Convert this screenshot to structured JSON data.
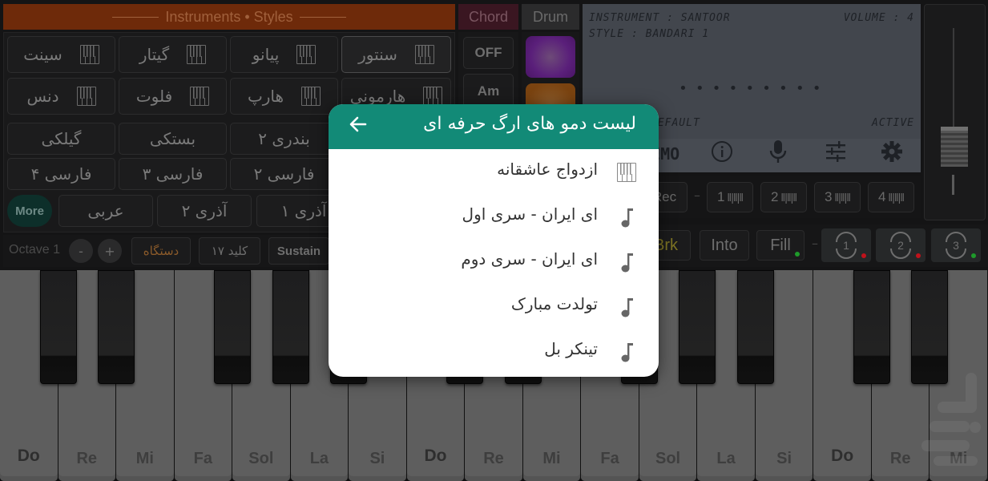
{
  "header": {
    "instruments_styles": "Instruments • Styles",
    "chord_tab": "Chord",
    "drum_tab": "Drum"
  },
  "instruments": [
    {
      "label": "سنتور",
      "active": true
    },
    {
      "label": "پیانو",
      "active": false
    },
    {
      "label": "گیتار",
      "active": false
    },
    {
      "label": "سینت",
      "active": false
    },
    {
      "label": "هارمونی",
      "active": false
    },
    {
      "label": "هارپ",
      "active": false
    },
    {
      "label": "فلوت",
      "active": false
    },
    {
      "label": "دنس",
      "active": false
    }
  ],
  "styles": [
    {
      "label": "بندری ۲"
    },
    {
      "label": "بستکی"
    },
    {
      "label": "گیلکی"
    },
    {
      "label": "فارسی ۲"
    },
    {
      "label": "فارسی ۳"
    },
    {
      "label": "فارسی ۴"
    },
    {
      "label": "آذری ۱"
    },
    {
      "label": "آذری ۲"
    },
    {
      "label": "عربی"
    }
  ],
  "more_label": "More",
  "controls": {
    "octave_label": "Octave 1",
    "minus": "-",
    "plus": "+",
    "dastgah": "دستگاه",
    "key": "کلید ۱۷",
    "sustain": "Sustain"
  },
  "chords": [
    "OFF",
    "Am"
  ],
  "drum_pads": [
    {
      "name": "pad-1",
      "color": "#5a1f7a"
    },
    {
      "name": "pad-2",
      "color": "#7a4310"
    }
  ],
  "lcd": {
    "instrument": "INSTRUMENT : SANTOOR",
    "volume": "VOLUME : 4",
    "style": "STYLE : BANDARI 1",
    "dots": "•••••••••",
    "default": "DEFAULT",
    "active": "ACTIVE",
    "demo": "DEMO"
  },
  "volume_slider": {
    "value_fraction": 0.7
  },
  "rec": {
    "rec_label": "Rec",
    "tracks": [
      "1",
      "2",
      "3",
      "4"
    ]
  },
  "style_controls": {
    "brk": "Brk",
    "into": "Into",
    "fill": "Fill",
    "variations": [
      {
        "label": "1",
        "status_color": "#c0121b"
      },
      {
        "label": "2",
        "status_color": "#c0121b"
      },
      {
        "label": "3",
        "status_color": "#1e9a2a"
      }
    ],
    "fill_status_color": "#1e9a2a"
  },
  "keyboard": {
    "white_keys": [
      "Do",
      "Re",
      "Mi",
      "Fa",
      "Sol",
      "La",
      "Si",
      "Do",
      "Re",
      "Mi",
      "Fa",
      "Sol",
      "La",
      "Si",
      "Do",
      "Re",
      "Mi"
    ]
  },
  "dialog": {
    "title": "لیست دمو های ارگ حرفه ای",
    "items": [
      {
        "label": "ازدواج عاشقانه",
        "icon": "piano-icon"
      },
      {
        "label": "ای ایران - سری اول",
        "icon": "music-note-icon"
      },
      {
        "label": "ای ایران - سری دوم",
        "icon": "music-note-icon"
      },
      {
        "label": "تولدت مبارک",
        "icon": "music-note-icon"
      },
      {
        "label": "تینکر بل",
        "icon": "music-note-icon"
      }
    ]
  },
  "colors": {
    "dialog_header": "#128a77",
    "instruments_header": "#6e2a0a",
    "lcd_bg": "#42464d"
  }
}
